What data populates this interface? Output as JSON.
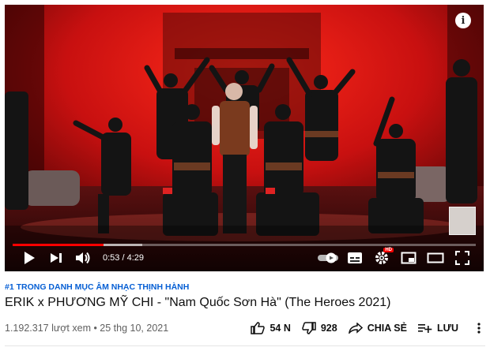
{
  "player": {
    "current_time": "0:53",
    "duration": "4:29",
    "time_separator": " / ",
    "progress_fraction": 0.197,
    "buffered_fraction": 0.28,
    "info_glyph": "i",
    "settings_badge": "HD",
    "accent_color": "#ff0000",
    "icons": [
      "play-icon",
      "next-icon",
      "volume-icon",
      "autoplay-toggle-icon",
      "subtitles-icon",
      "settings-icon",
      "miniplayer-icon",
      "theater-icon",
      "fullscreen-icon",
      "info-icon"
    ]
  },
  "video": {
    "hashtag": "#1 TRONG DANH MỤC ÂM NHẠC THỊNH HÀNH",
    "title": "ERIK x PHƯƠNG MỸ CHI - \"Nam Quốc Sơn Hà\" (The Heroes 2021)",
    "views_date": "1.192.317 lượt xem • 25 thg 10, 2021"
  },
  "actions": {
    "like_count": "54 N",
    "dislike_count": "928",
    "share_label": "CHIA SẺ",
    "save_label": "LƯU",
    "link_color": "#065fd4"
  }
}
